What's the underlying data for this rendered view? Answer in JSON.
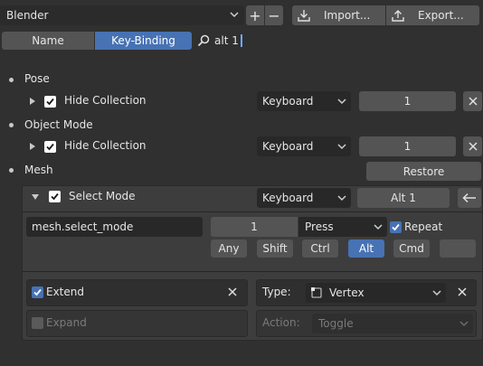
{
  "header": {
    "preset_value": "Blender",
    "add_label": "+",
    "remove_label": "−",
    "import_label": "Import...",
    "export_label": "Export..."
  },
  "filter": {
    "tabs": [
      "Name",
      "Key-Binding"
    ],
    "active_tab": "Key-Binding",
    "search_value": "alt 1"
  },
  "sections": {
    "pose": {
      "title": "Pose",
      "item": {
        "label": "Hide Collection",
        "input_type": "Keyboard",
        "key": "1"
      }
    },
    "object_mode": {
      "title": "Object Mode",
      "item": {
        "label": "Hide Collection",
        "input_type": "Keyboard",
        "key": "1"
      }
    },
    "mesh": {
      "title": "Mesh",
      "restore_label": "Restore",
      "item": {
        "label": "Select Mode",
        "input_type": "Keyboard",
        "key": "Alt 1",
        "operator": "mesh.select_mode",
        "key_value": "1",
        "event": "Press",
        "repeat_label": "Repeat",
        "modifiers": [
          "Any",
          "Shift",
          "Ctrl",
          "Alt",
          "Cmd"
        ],
        "active_modifier": "Alt",
        "props": {
          "extend_label": "Extend",
          "type_label": "Type:",
          "type_value": "Vertex",
          "expand_label": "Expand",
          "action_label": "Action:",
          "action_value": "Toggle"
        }
      }
    }
  },
  "colors": {
    "background": "#303030",
    "widget": "#545454",
    "field_dark": "#282828",
    "accent": "#4772b3"
  }
}
